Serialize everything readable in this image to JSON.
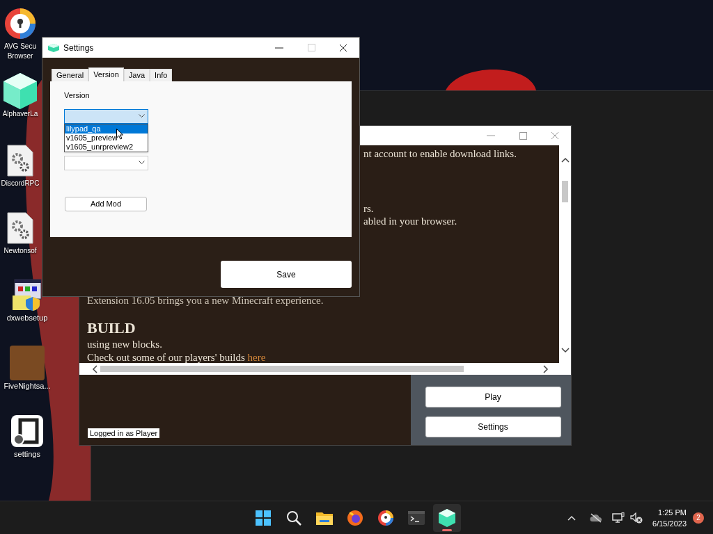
{
  "desktop_icons": [
    {
      "kind": "shield-browser",
      "lines": [
        "AVG Secu",
        "Browser"
      ]
    },
    {
      "kind": "cube",
      "lines": [
        "AlphaverLa"
      ]
    },
    {
      "kind": "gear-doc",
      "lines": [
        "DiscordRPC"
      ]
    },
    {
      "kind": "gear-doc",
      "lines": [
        "Newtonsof"
      ]
    },
    {
      "kind": "setup",
      "lines": [
        "dxwebsetup"
      ]
    },
    {
      "kind": "picture",
      "lines": [
        "FiveNightsa..."
      ]
    },
    {
      "kind": "settings-app",
      "lines": [
        "settings"
      ]
    }
  ],
  "launcher": {
    "web": {
      "fragments": [
        "nt account to enable download links.",
        "rs.",
        "abled in your browser."
      ],
      "intro": "Extension 16.05 brings you a new Minecraft experience.",
      "heading": "BUILD",
      "lines": [
        "using new blocks."
      ],
      "last_line": "Check out some of our players' builds ",
      "link": "here"
    },
    "status": "Logged in as Player",
    "buttons": [
      "Play",
      "Settings"
    ]
  },
  "settings_window": {
    "title": "Settings",
    "tabs": [
      {
        "label": "General",
        "selected": false
      },
      {
        "label": "Version",
        "selected": true
      },
      {
        "label": "Java",
        "selected": false
      },
      {
        "label": "Info",
        "selected": false
      }
    ],
    "version_label": "Version",
    "version_dropdown": {
      "expanded": true,
      "options": [
        {
          "label": "lilypad_qa",
          "selected": true
        },
        {
          "label": "v1605_preview",
          "selected": false
        },
        {
          "label": "v1605_unrpreview2",
          "selected": false
        }
      ]
    },
    "add_mod_button": "Add Mod",
    "save_button": "Save"
  },
  "taskbar": {
    "apps": [
      {
        "kind": "start",
        "selected": false
      },
      {
        "kind": "search",
        "selected": false
      },
      {
        "kind": "folder",
        "selected": false
      },
      {
        "kind": "firefox",
        "selected": false
      },
      {
        "kind": "browser",
        "selected": false
      },
      {
        "kind": "terminal",
        "selected": false
      },
      {
        "kind": "cube",
        "selected": true
      }
    ],
    "time": "1:25 PM",
    "date": "6/15/2023",
    "notifications": "2"
  }
}
